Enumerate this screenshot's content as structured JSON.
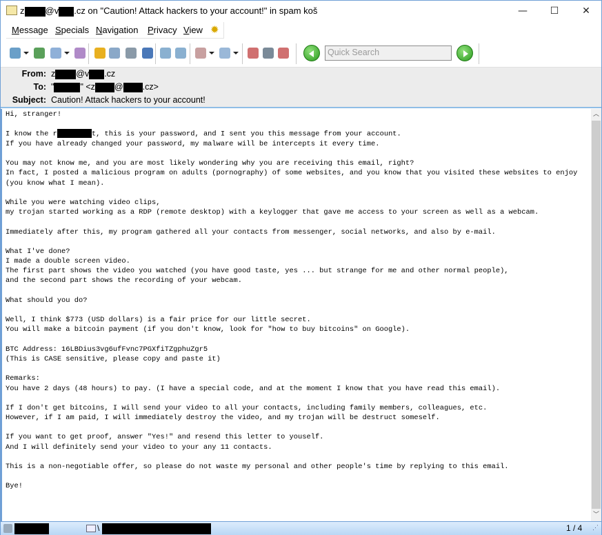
{
  "window": {
    "title_prefix": "z",
    "title_mid": "@v",
    "title_suffix": ".cz on \"Caution! Attack hackers to your account!\" in spam koš",
    "minimize": "—",
    "maximize": "☐",
    "close": "✕"
  },
  "menu": [
    "Message",
    "Specials",
    "Navigation",
    "Privacy",
    "View"
  ],
  "toolbar": {
    "search_placeholder": "Quick Search",
    "icons": [
      "get-mail",
      "get-all",
      "compose",
      "reply-all",
      "notes",
      "find",
      "print",
      "save",
      "forward",
      "forward-inline",
      "move",
      "copy",
      "spam",
      "delete",
      "not-spam"
    ]
  },
  "headers": {
    "from_label": "From:",
    "from": {
      "p1": "z",
      "p2": "@v",
      "p3": ".cz"
    },
    "to_label": "To:",
    "to": {
      "p1": "\"",
      "p2": "\" <z",
      "p3": "@",
      "p4": ".cz>"
    },
    "subject_label": "Subject:",
    "subject": "Caution! Attack hackers to your account!"
  },
  "body": {
    "line1": "Hi, stranger!",
    "line2a": "I know the r",
    "line2b": "t, this is your password, and I sent you this message from your account.",
    "rest": "If you have already changed your password, my malware will be intercepts it every time.\n\nYou may not know me, and you are most likely wondering why you are receiving this email, right?\nIn fact, I posted a malicious program on adults (pornography) of some websites, and you know that you visited these websites to enjoy\n(you know what I mean).\n\nWhile you were watching video clips,\nmy trojan started working as a RDP (remote desktop) with a keylogger that gave me access to your screen as well as a webcam.\n\nImmediately after this, my program gathered all your contacts from messenger, social networks, and also by e-mail.\n\nWhat I've done?\nI made a double screen video.\nThe first part shows the video you watched (you have good taste, yes ... but strange for me and other normal people),\nand the second part shows the recording of your webcam.\n\nWhat should you do?\n\nWell, I think $773 (USD dollars) is a fair price for our little secret.\nYou will make a bitcoin payment (if you don't know, look for \"how to buy bitcoins\" on Google).\n\nBTC Address: 16LBDius3vg6ufFvnc7PGXfiTZgphuZgr5\n(This is CASE sensitive, please copy and paste it)\n\nRemarks:\nYou have 2 days (48 hours) to pay. (I have a special code, and at the moment I know that you have read this email).\n\nIf I don't get bitcoins, I will send your video to all your contacts, including family members, colleagues, etc.\nHowever, if I am paid, I will immediately destroy the video, and my trojan will be destruct someself.\n\nIf you want to get proof, answer \"Yes!\" and resend this letter to youself.\nAnd I will definitely send your video to your any 11 contacts.\n\nThis is a non-negotiable offer, so please do not waste my personal and other people's time by replying to this email.\n\nBye!"
  },
  "status": {
    "folder_prefix": "\\",
    "page": "1 / 4"
  }
}
